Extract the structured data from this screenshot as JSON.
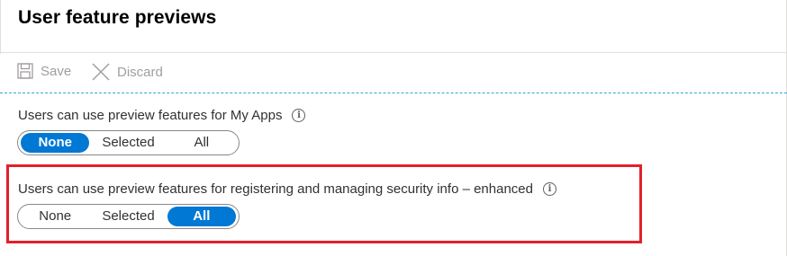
{
  "header": {
    "title": "User feature previews"
  },
  "toolbar": {
    "save_label": "Save",
    "discard_label": "Discard"
  },
  "settings": [
    {
      "label": "Users can use preview features for My Apps",
      "options": [
        "None",
        "Selected",
        "All"
      ],
      "selected": "None"
    },
    {
      "label": "Users can use preview features for registering and managing security info – enhanced",
      "options": [
        "None",
        "Selected",
        "All"
      ],
      "selected": "All"
    }
  ],
  "icons": {
    "save": "save-icon",
    "discard": "discard-icon",
    "info": "info-icon"
  },
  "colors": {
    "accent": "#0078d4",
    "highlight": "#e3202b",
    "disabled_text": "#a19f9d",
    "dashed_divider": "#2ea6cf"
  }
}
